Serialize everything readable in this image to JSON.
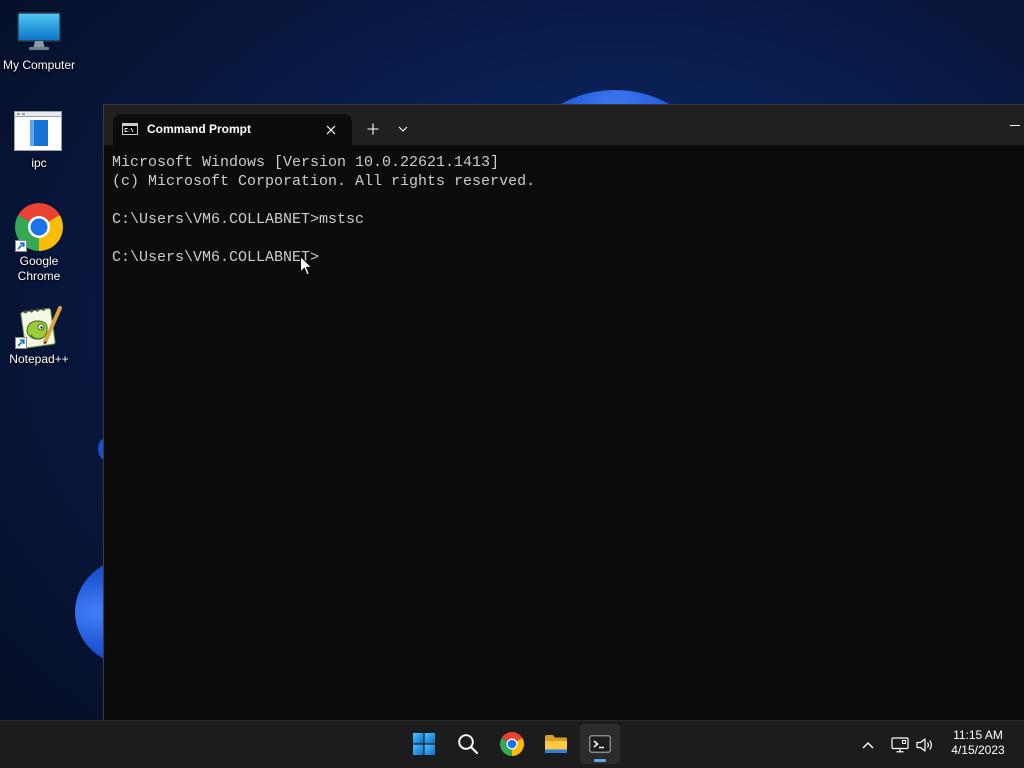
{
  "desktop": {
    "icons": [
      {
        "label": "My Computer",
        "icon": "monitor-icon"
      },
      {
        "label": "ipc",
        "icon": "document-icon"
      },
      {
        "label": "Google Chrome",
        "icon": "chrome-icon",
        "shortcut": true
      },
      {
        "label": "Notepad++",
        "icon": "notepad-plus-plus-icon",
        "shortcut": true
      }
    ]
  },
  "window": {
    "tab": {
      "title": "Command Prompt",
      "icon": "cmd-icon",
      "close_icon": "close-icon"
    },
    "new_tab_icon": "plus-icon",
    "dropdown_icon": "chevron-down-icon",
    "minimize_icon": "minimize-icon"
  },
  "terminal": {
    "lines": [
      "Microsoft Windows [Version 10.0.22621.1413]",
      "(c) Microsoft Corporation. All rights reserved.",
      "",
      "C:\\Users\\VM6.COLLABNET>mstsc",
      "",
      "C:\\Users\\VM6.COLLABNET>"
    ]
  },
  "taskbar": {
    "apps": [
      {
        "icon": "windows-start-icon"
      },
      {
        "icon": "search-icon"
      },
      {
        "icon": "chrome-icon"
      },
      {
        "icon": "file-explorer-icon"
      },
      {
        "icon": "terminal-icon",
        "active": true
      }
    ],
    "tray": [
      "chevron-up-icon",
      "network-icon",
      "volume-icon"
    ],
    "clock": {
      "time": "11:15 AM",
      "date": "4/15/2023"
    }
  },
  "colors": {
    "desktop_bg": "#0b2158",
    "terminal_bg": "#0c0c0c",
    "terminal_text": "#cccccc",
    "titlebar_bg": "#202020",
    "taskbar_bg": "#1c1c1c",
    "accent": "#5aa9e6"
  }
}
